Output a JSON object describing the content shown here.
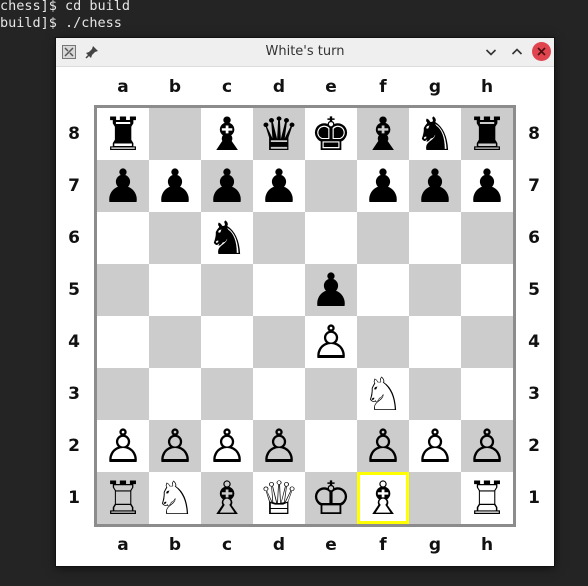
{
  "terminal": {
    "line1": "chess]$ cd build",
    "line2": "build]$ ./chess"
  },
  "window": {
    "title": "White's turn",
    "icons": {
      "app": "app-icon",
      "pin": "pin-icon",
      "minimize": "chevron-down-icon",
      "maximize": "chevron-up-icon",
      "close": "close-icon"
    },
    "colors": {
      "light_square": "#ffffff",
      "dark_square": "#cccccc",
      "selection": "#ffff00",
      "close_button": "#e0454f"
    }
  },
  "board": {
    "files": [
      "a",
      "b",
      "c",
      "d",
      "e",
      "f",
      "g",
      "h"
    ],
    "ranks": [
      "8",
      "7",
      "6",
      "5",
      "4",
      "3",
      "2",
      "1"
    ],
    "selected_square": "f1",
    "rows": [
      [
        "♜",
        "",
        "♝",
        "♛",
        "♚",
        "♝",
        "♞",
        "♜"
      ],
      [
        "♟",
        "♟",
        "♟",
        "♟",
        "",
        "♟",
        "♟",
        "♟"
      ],
      [
        "",
        "",
        "♞",
        "",
        "",
        "",
        "",
        ""
      ],
      [
        "",
        "",
        "",
        "",
        "♟",
        "",
        "",
        ""
      ],
      [
        "",
        "",
        "",
        "",
        "♙",
        "",
        "",
        ""
      ],
      [
        "",
        "",
        "",
        "",
        "",
        "♘",
        "",
        ""
      ],
      [
        "♙",
        "♙",
        "♙",
        "♙",
        "",
        "♙",
        "♙",
        "♙"
      ],
      [
        "♖",
        "♘",
        "♗",
        "♕",
        "♔",
        "♗",
        "",
        "♖"
      ]
    ]
  }
}
